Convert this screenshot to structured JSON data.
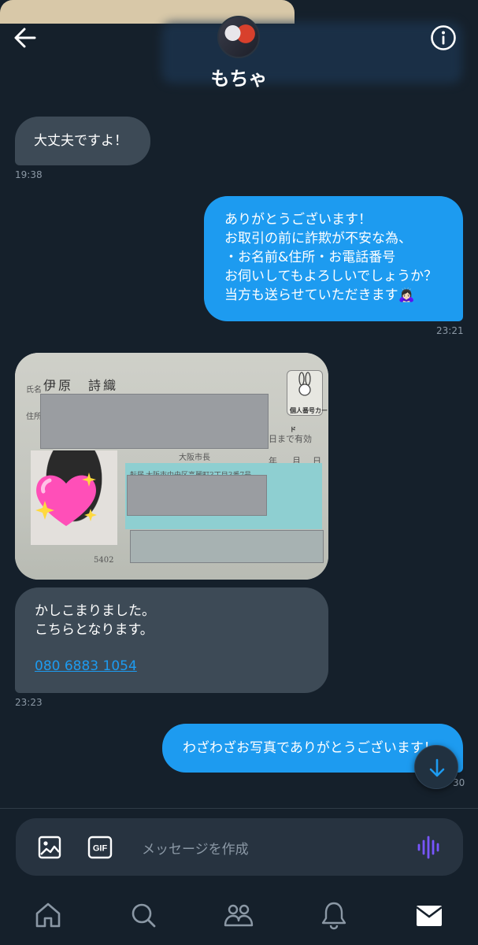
{
  "header": {
    "back_icon": "arrow-left-icon",
    "info_icon": "info-icon",
    "contact_name": "もちゃ"
  },
  "messages": [
    {
      "direction": "in",
      "text": "大丈夫ですよ！",
      "time": "19:38"
    },
    {
      "direction": "out",
      "lines": [
        "ありがとうございます！",
        "お取引の前に詐欺が不安な為、",
        "・お名前&住所・お電話番号",
        "お伺いしてもよろしいでしょうか？",
        "当方も送らせていただきます🙇🏻‍♀️"
      ],
      "time": "23:21"
    },
    {
      "direction": "in",
      "type": "image",
      "image": {
        "labels": {
          "name_label": "氏名",
          "address_label": "住所",
          "valid_until": "日まで有効",
          "year": "年",
          "month": "月",
          "day": "日",
          "card_type": "個人番号カード",
          "number_fragment": "5402",
          "transfer_label": "転居",
          "transfer_address": "大阪市中央区高麗町3丁目3番7号",
          "city": "大阪市長"
        },
        "holder_name": "伊原　詩織"
      }
    },
    {
      "direction": "in",
      "lines": [
        "かしこまりました。",
        "こちらとなります。"
      ],
      "phone": "080 6883 1054",
      "time": "23:23"
    },
    {
      "direction": "out",
      "text": "わざわざお写真でありがとうございます！",
      "time_partial": "30"
    }
  ],
  "composer": {
    "image_icon": "image-icon",
    "gif_label": "GIF",
    "placeholder": "メッセージを作成",
    "voice_icon": "voice-waveform-icon"
  },
  "jump_icon": "arrow-down-icon",
  "nav": [
    "home-icon",
    "search-icon",
    "communities-icon",
    "notifications-icon",
    "messages-icon"
  ],
  "colors": {
    "background": "#15202b",
    "incoming": "#3d4a56",
    "outgoing": "#1d9bf0",
    "muted": "#8b98a5",
    "voice": "#7856ff"
  }
}
